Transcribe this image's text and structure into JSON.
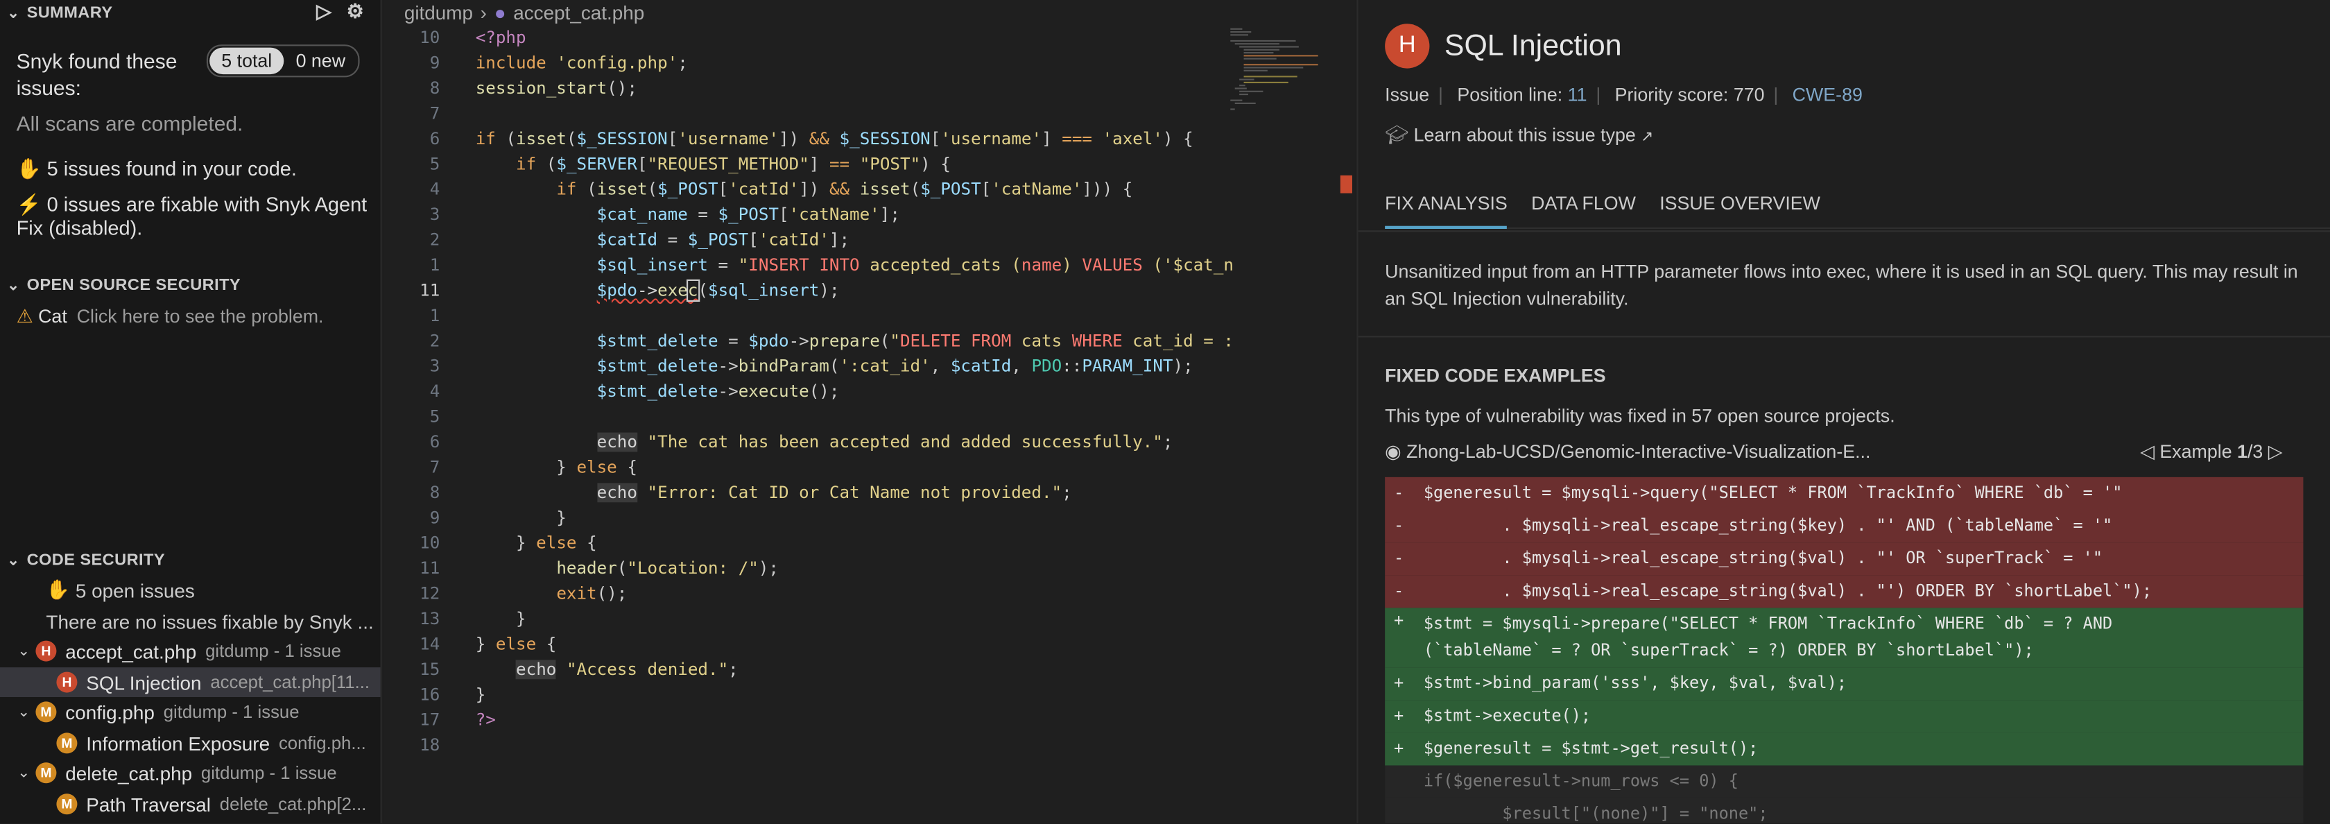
{
  "summary": {
    "header": "SUMMARY",
    "found_text": "Snyk found these issues:",
    "total_badge": "5 total",
    "new_badge": "0 new",
    "scans_done": "All scans are completed.",
    "issues_found_count": "5 issues",
    "issues_found_rest": "found in your code.",
    "fixable_count": "0 issues",
    "fixable_rest": "are fixable with Snyk Agent Fix (disabled)."
  },
  "oss": {
    "header": "OPEN SOURCE SECURITY",
    "item_label": "Cat",
    "item_desc": "Click here to see the problem."
  },
  "code_security": {
    "header": "CODE SECURITY",
    "open_issues": "5 open issues",
    "no_fixable": "There are no issues fixable by Snyk ...",
    "files": [
      {
        "name": "accept_cat.php",
        "desc": "gitdump - 1 issue",
        "sev": "H",
        "issue": {
          "name": "SQL Injection",
          "desc": "accept_cat.php[11..."
        }
      },
      {
        "name": "config.php",
        "desc": "gitdump - 1 issue",
        "sev": "M",
        "issue": {
          "name": "Information Exposure",
          "desc": "config.ph..."
        }
      },
      {
        "name": "delete_cat.php",
        "desc": "gitdump - 1 issue",
        "sev": "M",
        "issue": {
          "name": "Path Traversal",
          "desc": "delete_cat.php[2..."
        }
      }
    ]
  },
  "editor": {
    "breadcrumb_root": "gitdump",
    "breadcrumb_file": "accept_cat.php",
    "line_numbers": [
      "10",
      "9",
      "8",
      "7",
      "6",
      "5",
      "4",
      "3",
      "2",
      "1",
      "11",
      "1",
      "2",
      "3",
      "4",
      "5",
      "6",
      "7",
      "8",
      "9",
      "10",
      "11",
      "12",
      "13",
      "14",
      "15",
      "16",
      "17",
      "18"
    ],
    "current_line_index": 10
  },
  "details": {
    "severity_letter": "H",
    "title": "SQL Injection",
    "meta_issue": "Issue",
    "meta_position_label": "Position line:",
    "meta_position_value": "11",
    "meta_priority": "Priority score: 770",
    "meta_cwe": "CWE-89",
    "learn_link": "Learn about this issue type",
    "tabs": [
      "FIX ANALYSIS",
      "DATA FLOW",
      "ISSUE OVERVIEW"
    ],
    "description": "Unsanitized input from an HTTP parameter flows into exec, where it is used in an SQL query. This may result in an SQL Injection vulnerability.",
    "fixed_header": "FIXED CODE EXAMPLES",
    "fixed_text": "This type of vulnerability was fixed in 57 open source projects.",
    "repo": "Zhong-Lab-UCSD/Genomic-Interactive-Visualization-E...",
    "example_label": "Example",
    "example_current": "1",
    "example_total": "/3",
    "diff": [
      {
        "type": "rm",
        "mark": "-",
        "text": "$generesult = $mysqli->query(\"SELECT * FROM `TrackInfo` WHERE `db` = '\""
      },
      {
        "type": "rm",
        "mark": "-",
        "text": "        . $mysqli->real_escape_string($key) . \"' AND (`tableName` = '\""
      },
      {
        "type": "rm",
        "mark": "-",
        "text": "        . $mysqli->real_escape_string($val) . \"' OR `superTrack` = '\""
      },
      {
        "type": "rm",
        "mark": "-",
        "text": "        . $mysqli->real_escape_string($val) . \"') ORDER BY `shortLabel`\");"
      },
      {
        "type": "ad two",
        "mark": "+",
        "text": "$stmt = $mysqli->prepare(\"SELECT * FROM `TrackInfo` WHERE `db` = ? AND\n(`tableName` = ? OR `superTrack` = ?) ORDER BY `shortLabel`\");"
      },
      {
        "type": "ad",
        "mark": "+",
        "text": "$stmt->bind_param('sss', $key, $val, $val);"
      },
      {
        "type": "ad",
        "mark": "+",
        "text": "$stmt->execute();"
      },
      {
        "type": "ad",
        "mark": "+",
        "text": "$generesult = $stmt->get_result();"
      },
      {
        "type": "cx",
        "mark": "",
        "text": "if($generesult->num_rows <= 0) {"
      },
      {
        "type": "cx",
        "mark": "",
        "text": "        $result[\"(none)\"] = \"none\";"
      }
    ]
  }
}
